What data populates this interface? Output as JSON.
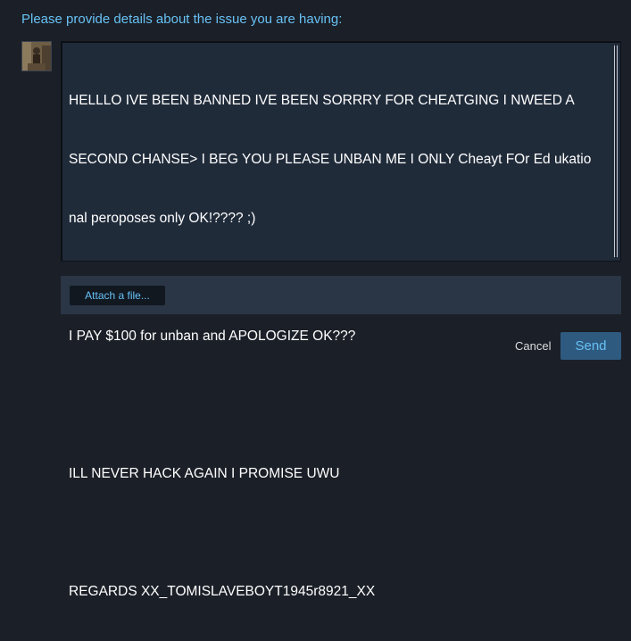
{
  "prompt": "Please provide details about the issue you are having:",
  "message": {
    "line1": "HELLLO IVE BEEN BANNED IVE BEEN SORRRY FOR CHEATGING I NWEED A",
    "line2": "SECOND CHANSE> I BEG YOU PLEASE UNBAN ME I ONLY Cheayt FOr Ed ukatio",
    "line3": "nal peroposes only OK!???? ;)",
    "line4": "I PAY $100 for unban and APOLOGIZE OK???",
    "line5": "ILL NEVER HACK AGAIN I PROMISE UWU",
    "line6": "REGARDS XX_TOMISLAVEBOYT1945r8921_XX"
  },
  "attach_label": "Attach a file...",
  "cancel_label": "Cancel",
  "send_label": "Send",
  "colors": {
    "background": "#1b1f27",
    "accent": "#67c1f5",
    "textarea_bg": "#202b3a",
    "attach_bar_bg": "#2a3546",
    "send_bg": "#2f5a7f"
  },
  "avatar_icon": "user-avatar-photo"
}
